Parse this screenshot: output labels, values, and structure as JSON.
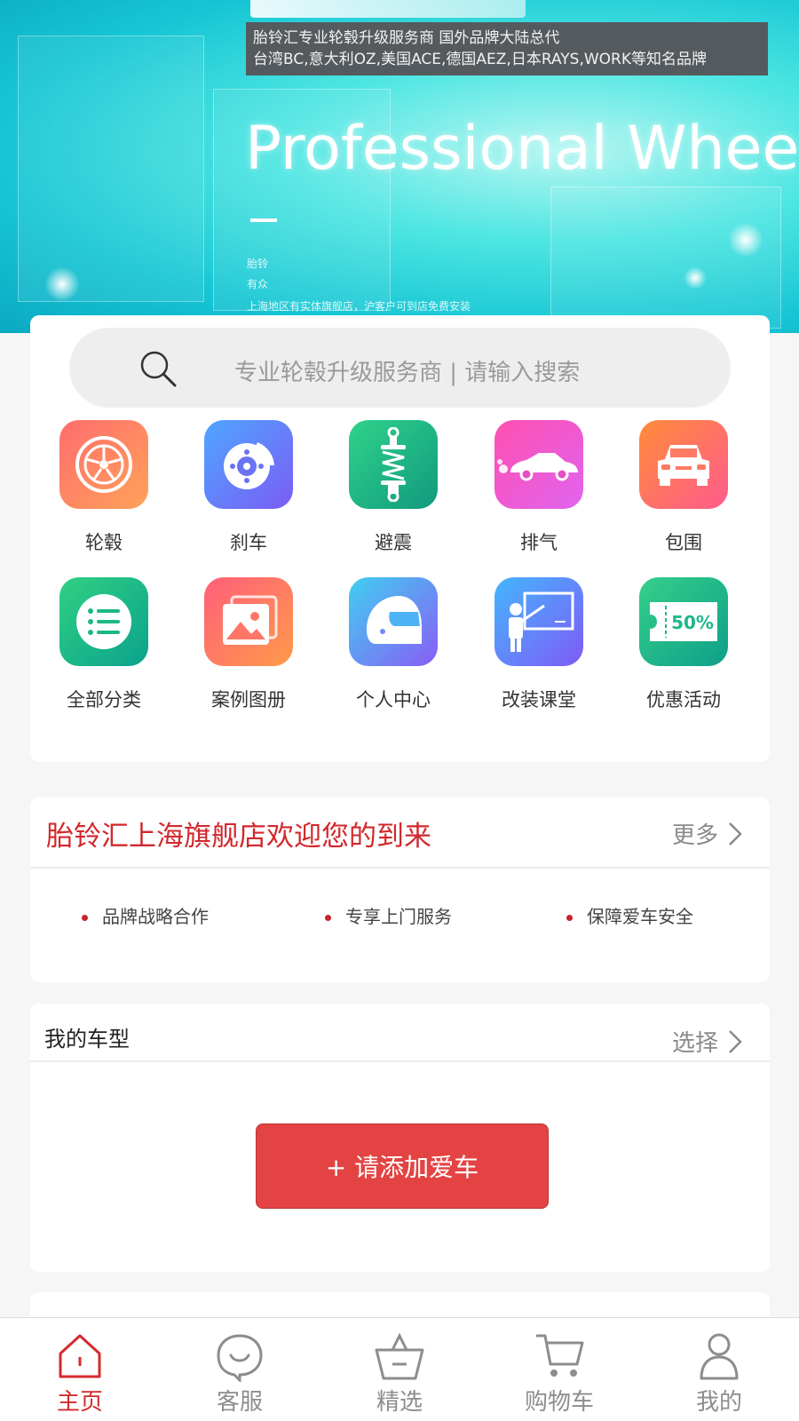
{
  "banner": {
    "info_line1": "胎铃汇专业轮毂升级服务商    国外品牌大陆总代",
    "info_line2": "台湾BC,意大利OZ,美国ACE,德国AEZ,日本RAYS,WORK等知名品牌",
    "title": "Professional Wheels",
    "small_line1": "胎铃",
    "small_line2": "有众",
    "small_line3": "上海地区有实体旗舰店，沪客户可到店免费安装"
  },
  "search": {
    "placeholder": "专业轮毂升级服务商 | 请输入搜索"
  },
  "categories": [
    {
      "label": "轮毂",
      "icon": "wheel-icon",
      "color_from": "#ff6d6d",
      "color_to": "#ffa25a"
    },
    {
      "label": "刹车",
      "icon": "brake-disc-icon",
      "color_from": "#4fa6ff",
      "color_to": "#7b5cf6"
    },
    {
      "label": "避震",
      "icon": "shock-absorber-icon",
      "color_from": "#2fd28b",
      "color_to": "#119a7e"
    },
    {
      "label": "排气",
      "icon": "exhaust-car-icon",
      "color_from": "#ff4fb0",
      "color_to": "#e064f0"
    },
    {
      "label": "包围",
      "icon": "car-front-icon",
      "color_from": "#ff8c3a",
      "color_to": "#ff5b8d"
    },
    {
      "label": "全部分类",
      "icon": "list-icon",
      "color_from": "#30d082",
      "color_to": "#0aa28d"
    },
    {
      "label": "案例图册",
      "icon": "gallery-icon",
      "color_from": "#ff5f7a",
      "color_to": "#ff9a4a"
    },
    {
      "label": "个人中心",
      "icon": "helmet-icon",
      "color_from": "#3fd0f0",
      "color_to": "#8a5cf6"
    },
    {
      "label": "改装课堂",
      "icon": "classroom-icon",
      "color_from": "#45b6ff",
      "color_to": "#7e5af5"
    },
    {
      "label": "优惠活动",
      "icon": "coupon-icon",
      "color_from": "#35d08a",
      "color_to": "#0e9f8a"
    }
  ],
  "welcome": {
    "heading": "胎铃汇上海旗舰店欢迎您的到来",
    "more_label": "更多",
    "bullets": [
      "品牌战略合作",
      "专享上门服务",
      "保障爱车安全"
    ]
  },
  "car_model": {
    "heading": "我的车型",
    "select_label": "选择",
    "add_button": "+ 请添加爱车"
  },
  "tabbar": {
    "items": [
      {
        "label": "主页",
        "icon": "home-icon",
        "active": true
      },
      {
        "label": "客服",
        "icon": "chat-icon",
        "active": false
      },
      {
        "label": "精选",
        "icon": "basket-icon",
        "active": false
      },
      {
        "label": "购物车",
        "icon": "cart-icon",
        "active": false
      },
      {
        "label": "我的",
        "icon": "user-icon",
        "active": false
      }
    ]
  },
  "colors": {
    "accent_red": "#d32a2e",
    "button_red": "#e44343",
    "banner_cyan": "#16c6d4"
  }
}
